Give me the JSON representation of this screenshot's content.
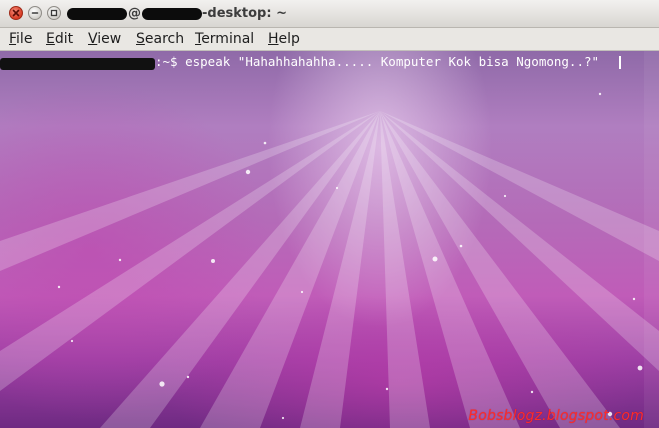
{
  "window": {
    "title_suffix": "-desktop: ~",
    "title_at": "@"
  },
  "menu": {
    "file": {
      "mnemonic": "F",
      "rest": "ile"
    },
    "edit": {
      "mnemonic": "E",
      "rest": "dit"
    },
    "view": {
      "mnemonic": "V",
      "rest": "iew"
    },
    "search": {
      "mnemonic": "S",
      "rest": "earch"
    },
    "terminal": {
      "mnemonic": "T",
      "rest": "erminal"
    },
    "help": {
      "mnemonic": "H",
      "rest": "elp"
    }
  },
  "terminal": {
    "prompt_suffix": ":~$ ",
    "command": "espeak \"Hahahhahahha..... Komputer Kok bisa Ngomong..?\""
  },
  "watermark": "Bobsblogz.blogspot.com",
  "colors": {
    "close_button": "#d73b24",
    "watermark": "#ff2a2a",
    "terminal_text": "#ffffff"
  }
}
